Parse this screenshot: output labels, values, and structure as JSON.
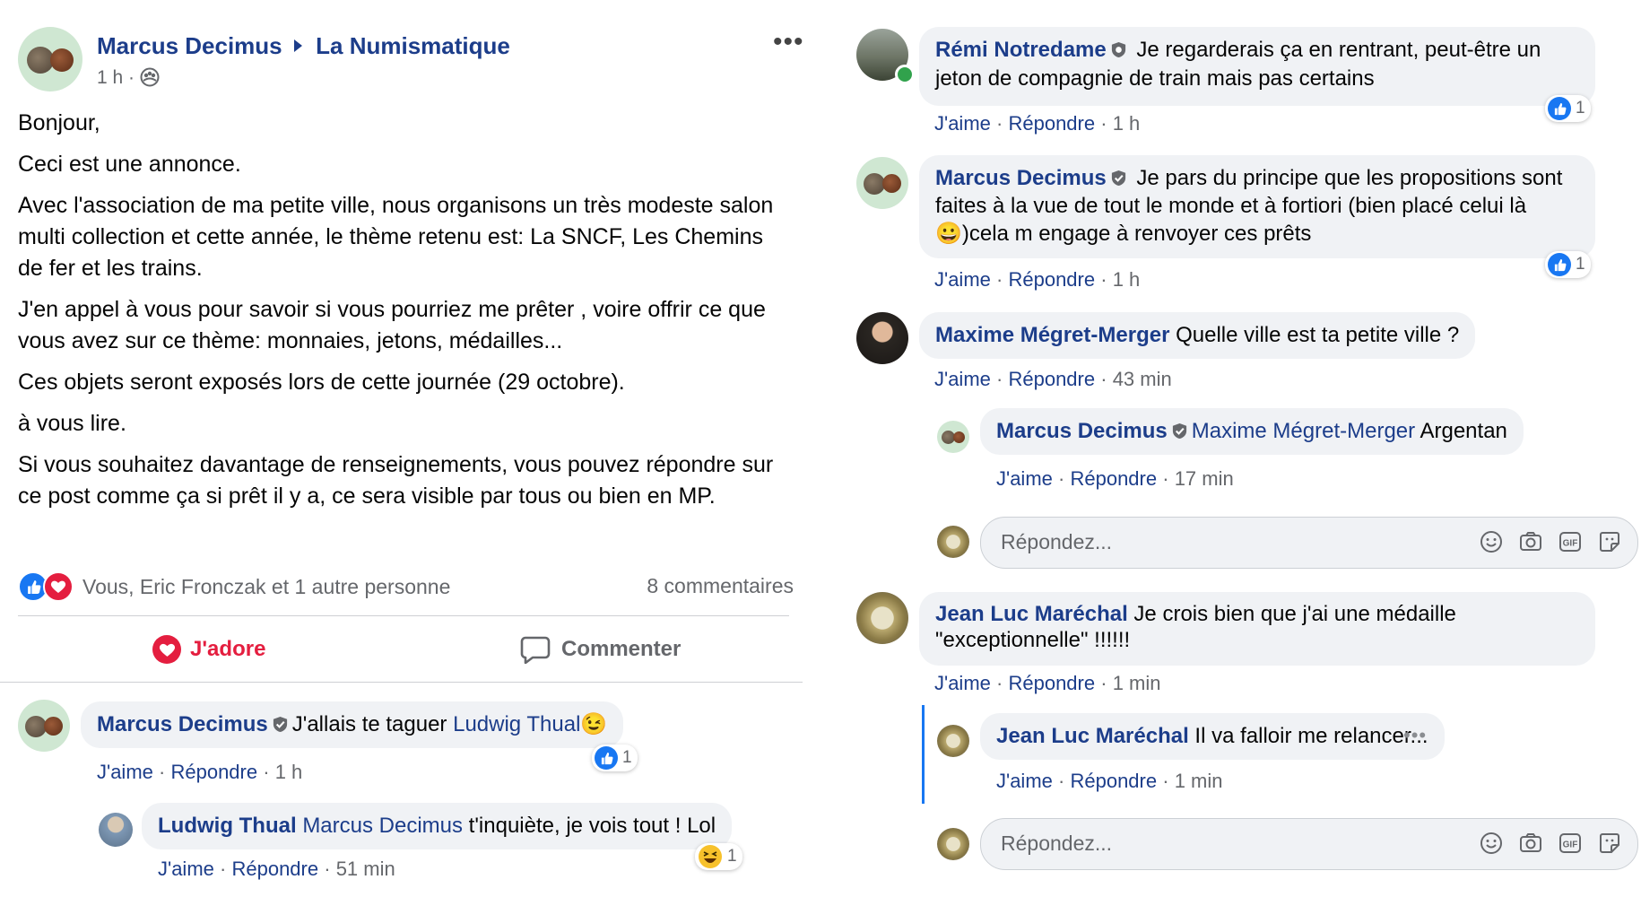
{
  "post": {
    "author": "Marcus Decimus",
    "group": "La Numismatique",
    "time": "1 h",
    "paragraphs": [
      "Bonjour,",
      "Ceci est une annonce.",
      "Avec l'association de ma petite ville, nous organisons un très modeste salon multi collection et cette année, le thème retenu est: La SNCF, Les Chemins de fer et les trains.",
      "J'en appel à vous pour savoir si vous pourriez me prêter , voire offrir ce que vous avez sur ce thème: monnaies, jetons, médailles...",
      "Ces objets seront exposés lors de cette journée (29 octobre).",
      "à vous lire.",
      "Si vous souhaitez davantage de renseignements, vous pouvez répondre sur ce post comme ça si prêt il y a, ce sera visible par tous ou bien en MP."
    ],
    "reactions_text": "Vous, Eric Fronczak et 1 autre personne",
    "comments_count": "8 commentaires",
    "love_label": "J'adore",
    "comment_label": "Commenter"
  },
  "actions": {
    "like": "J'aime",
    "reply": "Répondre",
    "sep": "·"
  },
  "reply_placeholder": "Répondez...",
  "comments": [
    {
      "author": "Marcus Decimus",
      "text_pre": "J'allais te taguer ",
      "tag": "Ludwig Thual",
      "text_post": "",
      "time": "1 h",
      "reaction_count": "1"
    },
    {
      "author": "Ludwig Thual",
      "tag": "Marcus Decimus",
      "text": " t'inquiète, je vois tout ! Lol",
      "time": "51 min",
      "reaction_count": "1"
    },
    {
      "author": "Rémi Notredame",
      "text": " Je regarderais ça en rentrant, peut-être un jeton de compagnie de train mais pas certains",
      "time": "1 h",
      "reaction_count": "1"
    },
    {
      "author": "Marcus Decimus",
      "text_pre": " Je pars du principe que les propositions sont faites à la vue de tout le monde et à fortiori (bien placé celui là ",
      "text_post": ")cela m engage à renvoyer ces prêts",
      "time": "1 h",
      "reaction_count": "1"
    },
    {
      "author": "Maxime Mégret-Merger",
      "text": " Quelle ville est ta petite ville ?",
      "time": "43 min"
    },
    {
      "author": "Marcus Decimus",
      "tag": "Maxime Mégret-Merger",
      "text": " Argentan",
      "time": "17 min"
    },
    {
      "author": "Jean Luc Maréchal",
      "text": " Je crois bien que j'ai une médaille \"exceptionnelle\" !!!!!!",
      "time": "1 min"
    },
    {
      "author": "Jean Luc Maréchal",
      "text": " Il va falloir me relancer...",
      "time": "1 min"
    }
  ],
  "colors": {
    "link": "#1c3d8a",
    "love": "#e41e3f",
    "like": "#1877f2",
    "grey": "#65676b",
    "bubble": "#f0f2f5"
  }
}
